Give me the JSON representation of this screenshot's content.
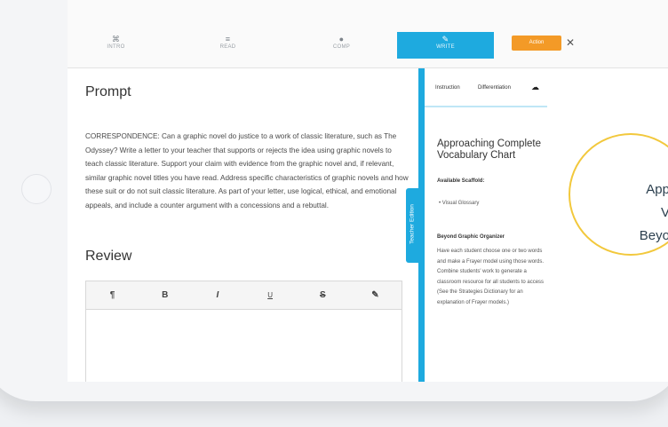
{
  "nav": {
    "tabs": [
      {
        "icon": "⌘",
        "label": "INTRO"
      },
      {
        "icon": "≡",
        "label": "READ"
      },
      {
        "icon": "●",
        "label": "COMP"
      },
      {
        "icon": "✎",
        "label": "WRITE"
      }
    ],
    "action_label": "Action",
    "close": "✕",
    "active_color": "#1eaadf",
    "action_color": "#f39a27"
  },
  "prompt": {
    "title": "Prompt",
    "text": "CORRESPONDENCE: Can a graphic novel do justice to a work of classic literature, such as The Odyssey? Write a letter to your teacher that supports or rejects the idea using graphic novels to teach classic literature. Support your claim with evidence from the graphic novel and, if relevant, similar graphic novel titles you have read. Address specific characteristics of graphic novels and how these suit or do not suit classic literature. As part of your letter, use logical, ethical, and emotional appeals, and include a counter argument with a concessions and a rebuttal."
  },
  "review": {
    "title": "Review",
    "toolbar": [
      "¶",
      "B",
      "I",
      "U",
      "S",
      "✎"
    ]
  },
  "teacher_edition": "Teacher Edition",
  "right_panel": {
    "tab_instruction": "Instruction",
    "tab_differentiation": "Differentiation",
    "cloud_icon": "☁",
    "heading": "Approaching Complete Vocabulary Chart",
    "available_scaffold": "Available Scaffold:",
    "bullet": "• Visual Glossary",
    "beyond_heading": "Beyond Graphic Organizer",
    "beyond_text": "Have each student choose one or two words and make a Frayer model using those words. Combine students' work to generate a classroom resource for all students to access (See the Strategies Dictionary for an explanation of Frayer models.)"
  },
  "callout": {
    "lines": [
      "App",
      "V",
      "Beyo"
    ]
  }
}
